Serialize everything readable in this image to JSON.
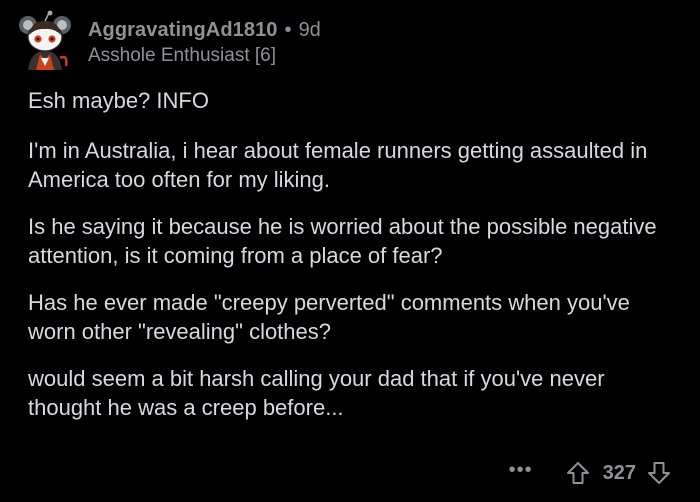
{
  "comment": {
    "author": "AggravatingAd1810",
    "separator": "•",
    "age": "9d",
    "flair": "Asshole Enthusiast [6]",
    "avatar_icon": "snoo-avatar-icon",
    "paragraphs": [
      "Esh maybe? INFO",
      "I'm in Australia, i hear about female runners getting assaulted in America too often for my liking.",
      "Is he saying it because he is worried about the possible negative attention, is it coming from a place of fear?",
      "Has he ever made \"creepy perverted\" comments when you've worn other \"revealing\" clothes?",
      "would seem a bit harsh calling your dad that if you've never thought he was a creep before..."
    ],
    "more_label": "•••",
    "score": "327",
    "upvote_icon": "upvote-arrow-icon",
    "downvote_icon": "downvote-arrow-icon"
  },
  "colors": {
    "background": "#000000",
    "text": "#d7dadc",
    "muted": "#8e9296"
  }
}
